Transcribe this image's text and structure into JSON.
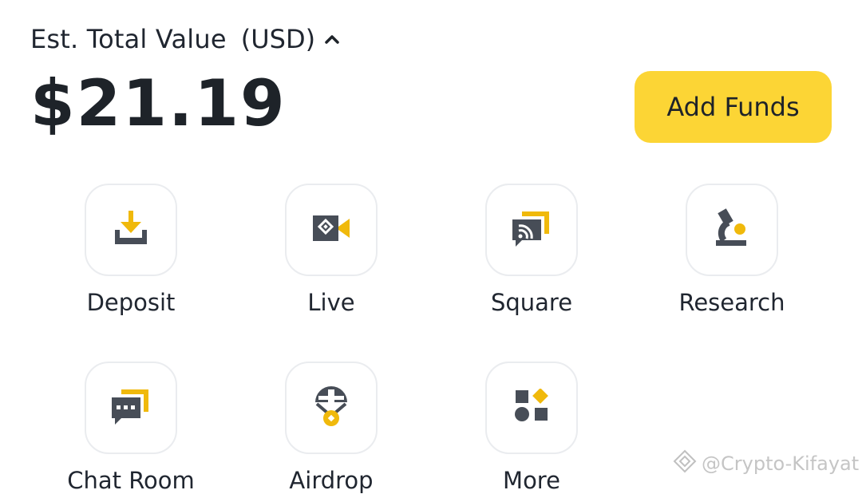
{
  "header": {
    "est_label": "Est. Total Value",
    "currency": "(USD)",
    "balance": "$21.19",
    "add_funds_label": "Add Funds"
  },
  "tiles": [
    {
      "label": "Deposit",
      "icon": "deposit-icon"
    },
    {
      "label": "Live",
      "icon": "live-camera-icon"
    },
    {
      "label": "Square",
      "icon": "square-feed-icon"
    },
    {
      "label": "Research",
      "icon": "microscope-icon"
    },
    {
      "label": "Chat Room",
      "icon": "chat-room-icon"
    },
    {
      "label": "Airdrop",
      "icon": "airdrop-parachute-icon"
    },
    {
      "label": "More",
      "icon": "more-shapes-icon"
    }
  ],
  "watermark": {
    "text": "@Crypto-Kifayat"
  },
  "colors": {
    "accent": "#FCD535",
    "icon_dark": "#474D57",
    "icon_yellow": "#F0B90B",
    "text": "#1E2329"
  }
}
